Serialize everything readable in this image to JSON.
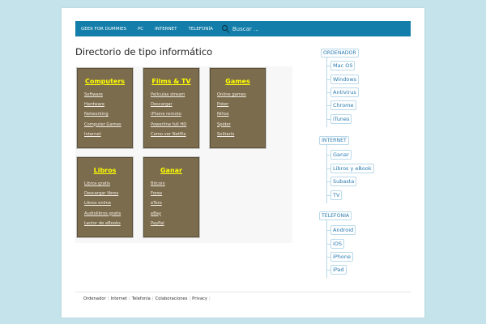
{
  "nav": {
    "items": [
      "GEEK FOR DUMMIES",
      "PC",
      "INTERNET",
      "TELEFONÍA"
    ],
    "search_placeholder": "Buscar ..."
  },
  "main": {
    "title": "Directorio de tipo informático",
    "cards": [
      {
        "title": "Computers",
        "links": [
          "Software",
          "Hardware",
          "Networking",
          "Computer Games",
          "Internet"
        ]
      },
      {
        "title": "Films & TV",
        "links": [
          "Películas stream",
          "Descargar",
          "iPhone remoto",
          "Powerline full HD",
          "Como ver Netflix"
        ]
      },
      {
        "title": "Games",
        "links": [
          "Online games",
          "Poker",
          "Niños",
          "Spider",
          "Solitario"
        ]
      },
      {
        "title": "Libros",
        "links": [
          "Libros gratis",
          "Descargar libros",
          "Libros online",
          "Audiolibros gratis",
          "Lector de eBooks"
        ]
      },
      {
        "title": "Ganar",
        "links": [
          "Bitcoin",
          "Forex",
          "eToro",
          "eBay",
          "PayPal"
        ]
      }
    ]
  },
  "sidebar": {
    "groups": [
      {
        "label": "ORDENADOR",
        "items": [
          "Mac OS",
          "Windows",
          "Antivirus",
          "Chrome",
          "iTunes"
        ]
      },
      {
        "label": "INTERNET",
        "items": [
          "Ganar",
          "Libros y eBook",
          "Subasta",
          "TV"
        ]
      },
      {
        "label": "TELEFONIA",
        "items": [
          "Android",
          "iOS",
          "iPhone",
          "iPad"
        ]
      }
    ]
  },
  "footer": {
    "links": [
      "Ordenador",
      "Internet",
      "Telefonía",
      "Colaboraciones",
      "Privacy"
    ]
  }
}
